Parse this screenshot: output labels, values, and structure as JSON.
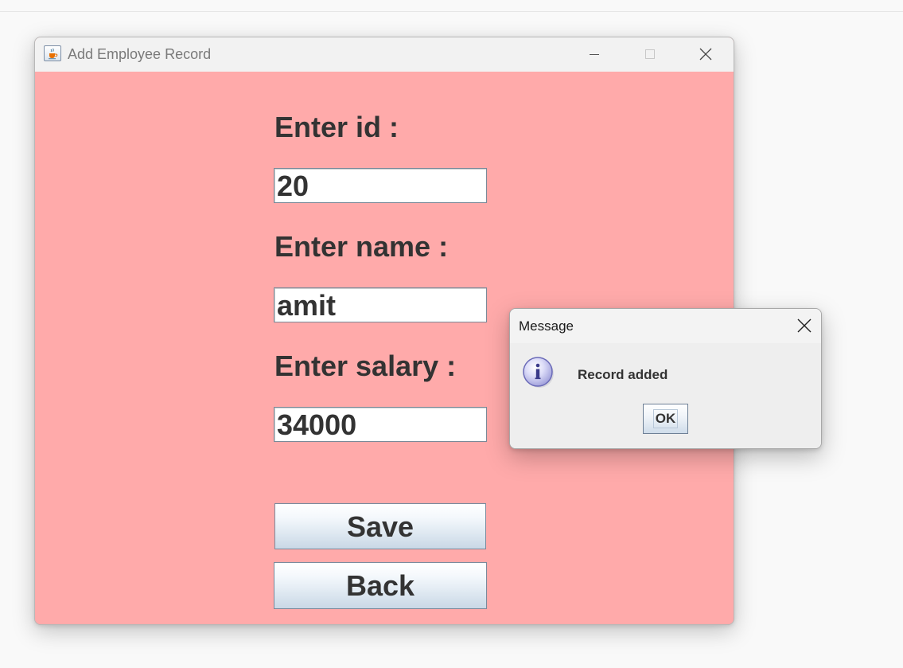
{
  "window": {
    "title": "Add Employee Record",
    "icon": "java-cup-icon",
    "controls": [
      "minimize-icon",
      "maximize-icon",
      "close-icon"
    ],
    "background_color": "#ffaaaa"
  },
  "form": {
    "id_label": "Enter id :",
    "id_value": "20",
    "name_label": "Enter name :",
    "name_value": "amit",
    "salary_label": "Enter salary :",
    "salary_value": "34000",
    "save_label": "Save",
    "back_label": "Back"
  },
  "dialog": {
    "title": "Message",
    "message": "Record added",
    "icon": "info-icon",
    "ok_label": "OK"
  }
}
